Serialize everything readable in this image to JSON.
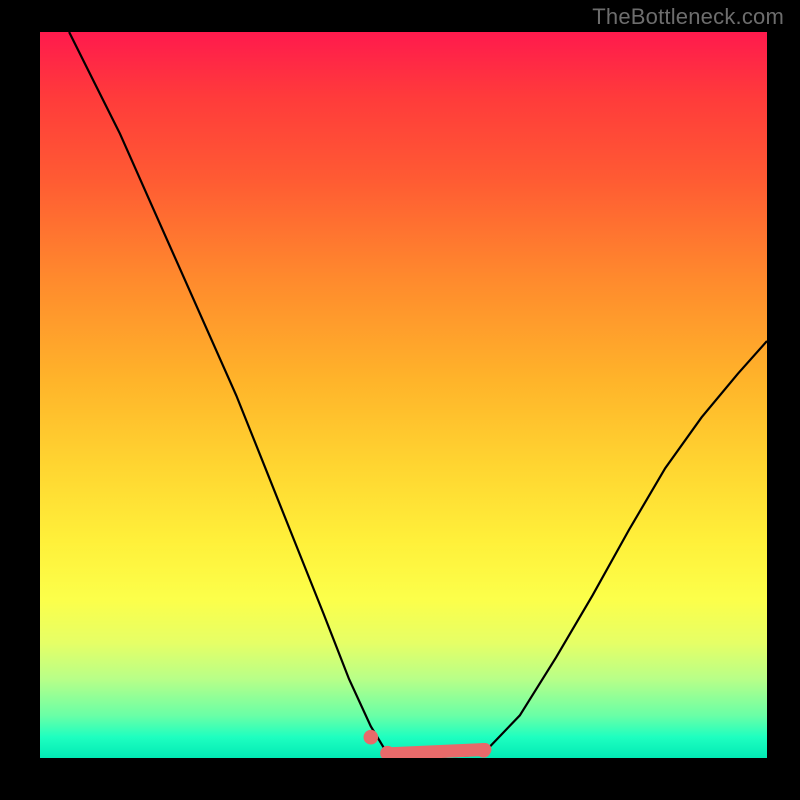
{
  "watermark": "TheBottleneck.com",
  "colors": {
    "background": "#000000",
    "curve": "#000000",
    "marker": "#e86a6a",
    "gradient_top": "#ff1a4d",
    "gradient_bottom": "#00e8b4"
  },
  "chart_data": {
    "type": "line",
    "title": "",
    "xlabel": "",
    "ylabel": "",
    "xlim": [
      0,
      1
    ],
    "ylim": [
      0,
      1
    ],
    "grid": false,
    "legend": false,
    "series": [
      {
        "name": "left-curve",
        "x": [
          0.04,
          0.075,
          0.11,
          0.15,
          0.19,
          0.23,
          0.27,
          0.31,
          0.35,
          0.39,
          0.425,
          0.455,
          0.478
        ],
        "y": [
          1.0,
          0.93,
          0.86,
          0.77,
          0.68,
          0.59,
          0.5,
          0.4,
          0.3,
          0.2,
          0.11,
          0.045,
          0.007
        ]
      },
      {
        "name": "flat-bottom",
        "x": [
          0.478,
          0.51,
          0.55,
          0.59,
          0.615
        ],
        "y": [
          0.007,
          0.003,
          0.003,
          0.005,
          0.013
        ]
      },
      {
        "name": "right-curve",
        "x": [
          0.615,
          0.66,
          0.71,
          0.76,
          0.81,
          0.86,
          0.91,
          0.96,
          1.0
        ],
        "y": [
          0.013,
          0.06,
          0.14,
          0.225,
          0.315,
          0.4,
          0.47,
          0.53,
          0.575
        ]
      }
    ],
    "markers": [
      {
        "name": "left-dot",
        "x": 0.455,
        "y": 0.03,
        "r": 0.01
      },
      {
        "name": "bottom-blob-start",
        "x": 0.478,
        "y": 0.008,
        "r": 0.01
      },
      {
        "name": "bottom-blob-end",
        "x": 0.61,
        "y": 0.012,
        "r": 0.01
      }
    ],
    "marker_strip": {
      "x_start": 0.478,
      "x_end": 0.612,
      "y": 0.007,
      "thickness": 0.018
    }
  }
}
